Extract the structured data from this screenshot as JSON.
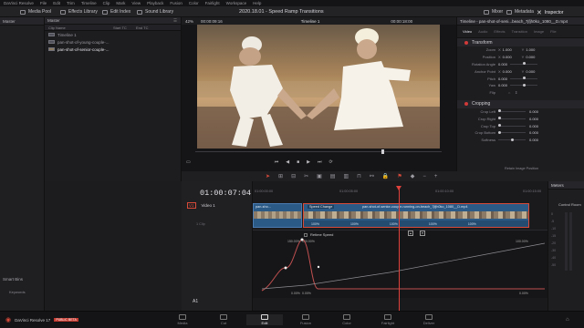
{
  "menubar": [
    "DaVinci Resolve",
    "File",
    "Edit",
    "Trim",
    "Timeline",
    "Clip",
    "Mark",
    "View",
    "Playback",
    "Fusion",
    "Color",
    "Fairlight",
    "Workspace",
    "Help"
  ],
  "toolbar": {
    "left": [
      "Media Pool",
      "Effects Library",
      "Edit Index",
      "Sound Library"
    ],
    "project": "2020.18.01 - Speed Ramp Transitions",
    "right": [
      "Mixer",
      "Metadata",
      "Inspector"
    ]
  },
  "leftpanel": {
    "title": "Master",
    "smart_bins": "Smart Bins",
    "keywords": "Keywords"
  },
  "mediapool": {
    "title": "Master",
    "columns": [
      "Clip Name",
      "Start TC",
      "End TC"
    ],
    "clips": [
      {
        "name": "Timeline 1",
        "selected": false
      },
      {
        "name": "pan-shot-of-young-couple-...",
        "selected": false
      },
      {
        "name": "pan-shot-of-senior-couple-...",
        "selected": true
      }
    ]
  },
  "viewer": {
    "zoom": "42%",
    "timecode_in": "00:00:09:16",
    "timeline_name": "Timeline 1",
    "timecode_out": "00:00:18:00"
  },
  "inspector": {
    "title": "Timeline - pan-shot-of-seni...beach_7jfjh0ko_1080__D.mp4",
    "tabs": [
      "Video",
      "Audio",
      "Effects",
      "Transition",
      "Image",
      "File"
    ],
    "transform_label": "Transform",
    "transform": [
      {
        "label": "Zoom",
        "x": "1.000",
        "y": "1.000"
      },
      {
        "label": "Position",
        "x": "0.000",
        "y": "0.000"
      },
      {
        "label": "Rotation Angle",
        "x": "0.000"
      },
      {
        "label": "Anchor Point",
        "x": "0.000",
        "y": "0.000"
      },
      {
        "label": "Pitch",
        "x": "0.000"
      },
      {
        "label": "Yaw",
        "x": "0.000"
      },
      {
        "label": "Flip",
        "x": ""
      }
    ],
    "cropping_label": "Cropping",
    "cropping": [
      {
        "label": "Crop Left",
        "x": "0.000"
      },
      {
        "label": "Crop Right",
        "x": "0.000"
      },
      {
        "label": "Crop Top",
        "x": "0.000"
      },
      {
        "label": "Crop Bottom",
        "x": "0.000"
      },
      {
        "label": "Softness",
        "x": "0.000"
      }
    ],
    "retain": "Retain Image Position"
  },
  "timeline": {
    "timecode": "01:00:07:04",
    "ruler": [
      "01:00:00:00",
      "01:00:05:00",
      "01:00:10:00",
      "01:00:15:00"
    ],
    "track": {
      "id": "V1",
      "name": "Video 1",
      "clips": "1 Clip"
    },
    "audio_track": "A1",
    "clip_left": "pan-sho...",
    "speed_label": "Speed Change",
    "clip_main": "pan-shot-of-senior-couple-running-on-beach_7jfjh0ko_1080__D.mp4",
    "speeds": [
      "100%",
      "100%",
      "100%",
      "100%",
      "100%"
    ],
    "curve_title": "Retime Speed",
    "curve_labels": [
      "150.00%",
      "100.00%",
      "100.00%",
      "0.00%",
      "0.00%",
      "100.00%",
      "0.00%"
    ]
  },
  "meters": {
    "title": "Meters",
    "control": "Control Room",
    "scale": [
      "0",
      "-5",
      "-10",
      "-15",
      "-20",
      "-30",
      "-40",
      "-50"
    ]
  },
  "nav": {
    "app": "DaVinci Resolve 17",
    "badge": "PUBLIC BETA",
    "pages": [
      "Media",
      "Cut",
      "Edit",
      "Fusion",
      "Color",
      "Fairlight",
      "Deliver"
    ],
    "active": "Edit"
  },
  "colors": {
    "accent": "#d74a3a",
    "clip_blue": "#2c5a86",
    "playhead": "#e0413b"
  }
}
